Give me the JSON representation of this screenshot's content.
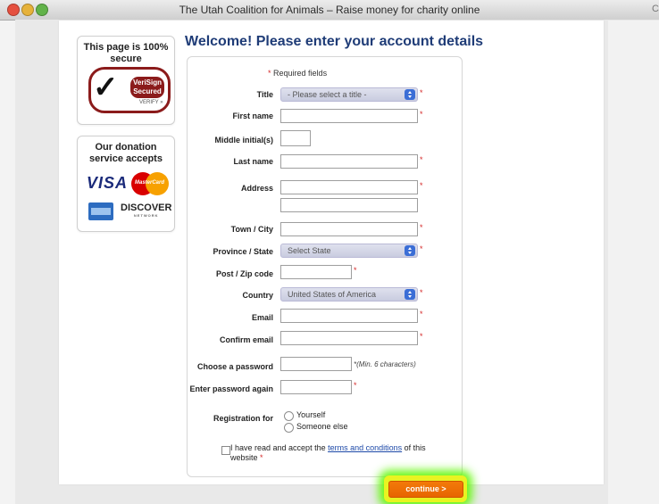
{
  "window": {
    "title": "The Utah Coalition for Animals – Raise money for charity online",
    "edge_glyph": "C"
  },
  "sidebar": {
    "secure_text": "This page is 100% secure",
    "seal": {
      "name": "VeriSign Secured",
      "line1": "VeriSign",
      "line2": "Secured",
      "verify": "VERIFY »"
    },
    "accepts_text": "Our donation service accepts",
    "cards": [
      "VISA",
      "MasterCard",
      "American Express",
      "DISCOVER"
    ],
    "mastercard_label": "MasterCard",
    "discover_sub": "NETWORK"
  },
  "heading": "Welcome! Please enter your account details",
  "form": {
    "required_note": "Required fields",
    "required_mark": "*",
    "labels": {
      "title": "Title",
      "first_name": "First name",
      "middle": "Middle initial(s)",
      "last_name": "Last name",
      "address": "Address",
      "town": "Town / City",
      "province": "Province / State",
      "post": "Post / Zip code",
      "country": "Country",
      "email": "Email",
      "confirm_email": "Confirm email",
      "password": "Choose a password",
      "password_again": "Enter password again",
      "registration": "Registration for"
    },
    "selects": {
      "title": "- Please select a title -",
      "province": "Select State",
      "country": "United States of America"
    },
    "password_hint": "*(Min. 6 characters)",
    "registration_options": [
      "Yourself",
      "Someone else"
    ],
    "terms": {
      "before": "I have read and accept the ",
      "link": "terms and conditions",
      "after": " of this website"
    }
  },
  "continue_button": "continue >",
  "colors": {
    "heading": "#1f3c77",
    "required": "#d52b2b",
    "button": "#e76500",
    "highlight": "#5cf700",
    "link": "#1d49a8"
  }
}
